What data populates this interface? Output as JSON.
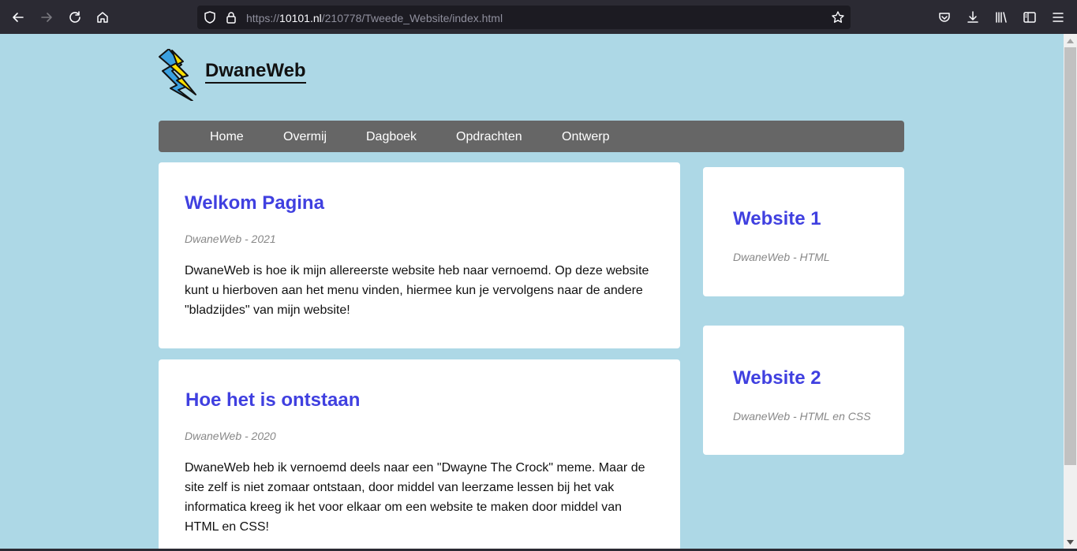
{
  "browser": {
    "url_prefix": "https://",
    "url_host": "10101.nl",
    "url_path": "/210778/Tweede_Website/index.html"
  },
  "site": {
    "logo_text": "DwaneWeb"
  },
  "nav": {
    "items": [
      "Home",
      "Overmij",
      "Dagboek",
      "Opdrachten",
      "Ontwerp"
    ]
  },
  "main": {
    "posts": [
      {
        "title": "Welkom Pagina",
        "meta": "DwaneWeb - 2021",
        "body": "DwaneWeb is hoe ik mijn allereerste website heb naar vernoemd. Op deze website kunt u hierboven aan het menu vinden, hiermee kun je vervolgens naar de andere \"bladzijdes\" van mijn website!"
      },
      {
        "title": "Hoe het is ontstaan",
        "meta": "DwaneWeb - 2020",
        "body": "DwaneWeb heb ik vernoemd deels naar een \"Dwayne The Crock\" meme. Maar de site zelf is niet zomaar ontstaan, door middel van leerzame lessen bij het vak informatica kreeg ik het voor elkaar om een website te maken door middel van HTML en CSS!"
      }
    ]
  },
  "sidebar": {
    "cards": [
      {
        "title": "Website 1",
        "meta": "DwaneWeb - HTML"
      },
      {
        "title": "Website 2",
        "meta": "DwaneWeb - HTML en CSS"
      }
    ]
  },
  "colors": {
    "page_bg": "#add8e6",
    "nav_bg": "#666666",
    "heading": "#4040e0",
    "toolbar_bg": "#2b2a33"
  },
  "icons": [
    "back-icon",
    "forward-icon",
    "reload-icon",
    "home-icon",
    "shield-icon",
    "lock-icon",
    "star-icon",
    "pocket-icon",
    "download-icon",
    "library-icon",
    "sidebar-icon",
    "menu-icon"
  ]
}
